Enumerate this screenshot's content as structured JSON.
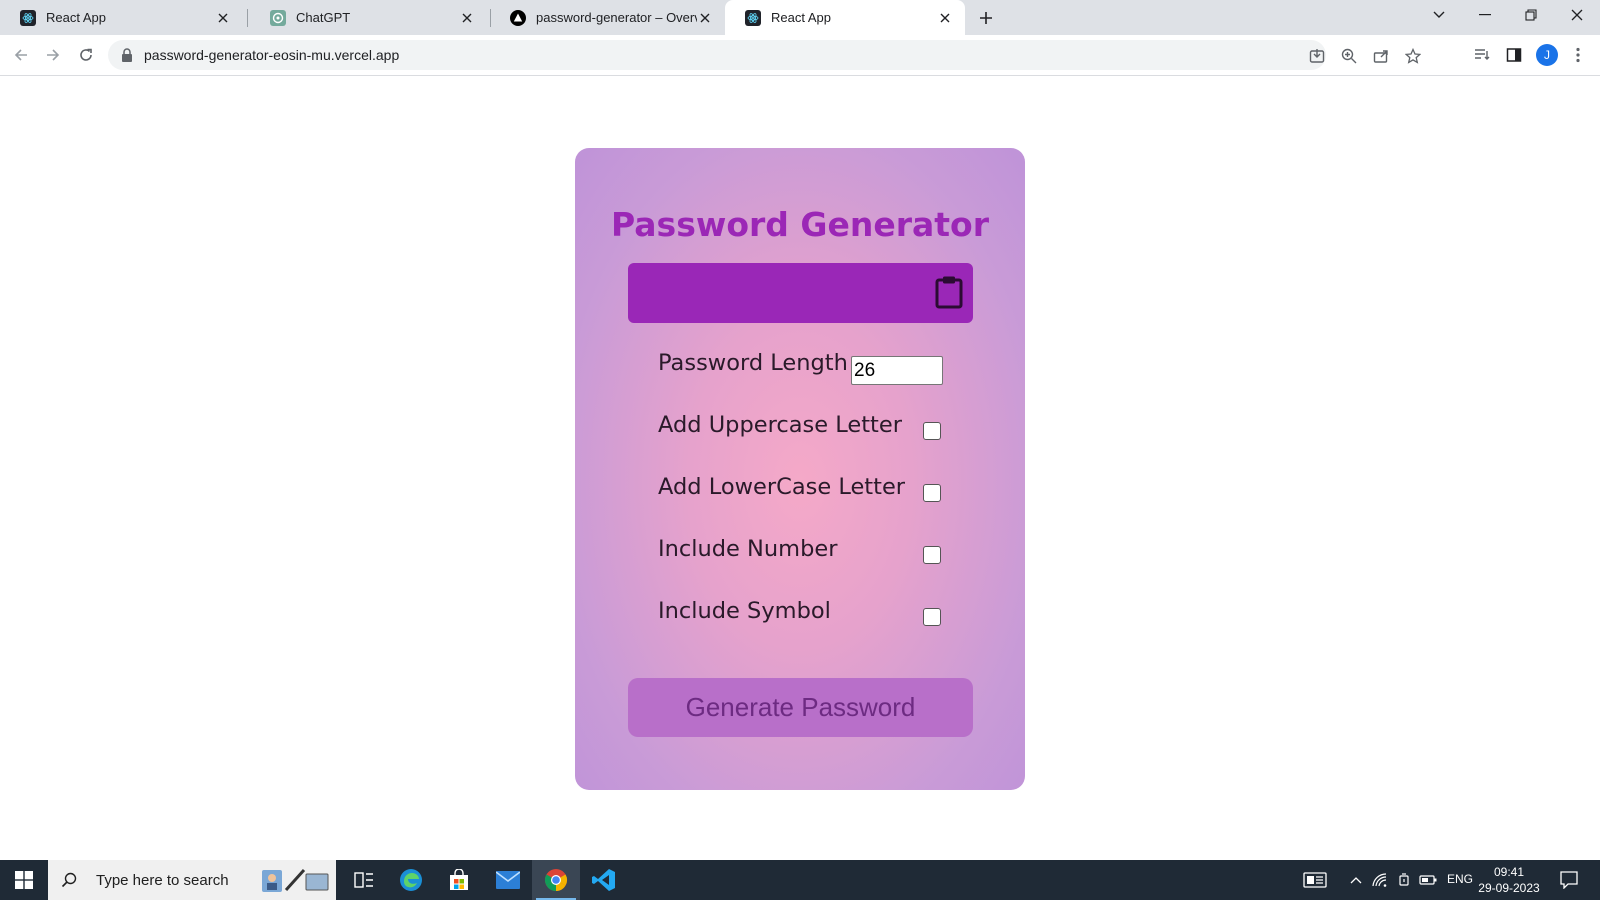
{
  "browser": {
    "tabs": [
      {
        "title": "React App",
        "favicon": "react-icon",
        "active": false
      },
      {
        "title": "ChatGPT",
        "favicon": "chatgpt-icon",
        "active": false
      },
      {
        "title": "password-generator – Overview",
        "favicon": "vercel-icon",
        "active": false
      },
      {
        "title": "React App",
        "favicon": "react-icon",
        "active": true
      }
    ],
    "url": "password-generator-eosin-mu.vercel.app",
    "profile_initial": "J"
  },
  "app": {
    "title": "Password Generator",
    "password_value": "",
    "length_label": "Password Length",
    "length_value": "26",
    "options": [
      {
        "label": "Add Uppercase Letter",
        "checked": false
      },
      {
        "label": "Add LowerCase Letter",
        "checked": false
      },
      {
        "label": "Include Number",
        "checked": false
      },
      {
        "label": "Include Symbol",
        "checked": false
      }
    ],
    "generate_label": "Generate Password",
    "colors": {
      "title": "#9b27b6",
      "display_bg": "#9a27b7",
      "button_bg": "#b86fc9",
      "button_text": "#6d2b82"
    }
  },
  "taskbar": {
    "search_placeholder": "Type here to search",
    "language": "ENG",
    "time": "09:41",
    "date": "29-09-2023"
  }
}
